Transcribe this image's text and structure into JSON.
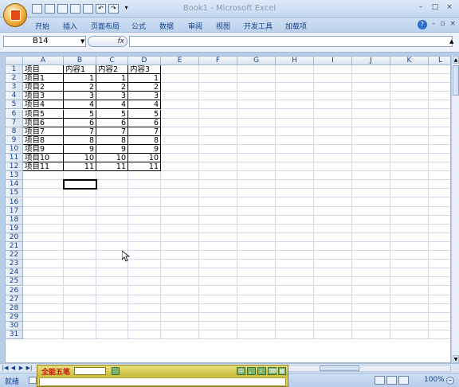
{
  "window": {
    "title": "Book1 - Microsoft Excel",
    "controls": [
      "–",
      "□",
      "×"
    ]
  },
  "qat": {
    "undo_symbol": "↶",
    "redo_symbol": "↷",
    "more_symbol": "▾"
  },
  "ribbon": {
    "tabs": [
      "开始",
      "插入",
      "页面布局",
      "公式",
      "数据",
      "审阅",
      "视图",
      "开发工具",
      "加载项"
    ],
    "help": "?",
    "right_controls": [
      "–",
      "▫",
      "×"
    ]
  },
  "formula_bar": {
    "name_box": "B14",
    "fx_label": "fx",
    "formula": ""
  },
  "columns": [
    "A",
    "B",
    "C",
    "D",
    "E",
    "F",
    "G",
    "H",
    "I",
    "J",
    "K",
    "L"
  ],
  "rows": [
    "1",
    "2",
    "3",
    "4",
    "5",
    "6",
    "7",
    "8",
    "9",
    "10",
    "11",
    "12",
    "13",
    "14",
    "15",
    "16",
    "17",
    "18",
    "19",
    "20",
    "21",
    "22",
    "23",
    "24",
    "25",
    "26",
    "27",
    "28",
    "29",
    "30",
    "31"
  ],
  "table": {
    "header": [
      "项目",
      "内容1",
      "内容2",
      "内容3"
    ],
    "rows": [
      [
        "项目1",
        "1",
        "1",
        "1"
      ],
      [
        "项目2",
        "2",
        "2",
        "2"
      ],
      [
        "项目3",
        "3",
        "3",
        "3"
      ],
      [
        "项目4",
        "4",
        "4",
        "4"
      ],
      [
        "项目5",
        "5",
        "5",
        "5"
      ],
      [
        "项目6",
        "6",
        "6",
        "6"
      ],
      [
        "项目7",
        "7",
        "7",
        "7"
      ],
      [
        "项目8",
        "8",
        "8",
        "8"
      ],
      [
        "项目9",
        "9",
        "9",
        "9"
      ],
      [
        "项目10",
        "10",
        "10",
        "10"
      ],
      [
        "项目11",
        "11",
        "11",
        "11"
      ]
    ]
  },
  "active_cell": "B14",
  "status": {
    "ready": "就绪",
    "zoom": "100%",
    "zoom_out": "–"
  },
  "ime": {
    "name": "全能五笔"
  },
  "colors": {
    "accent": "#15428b",
    "grid_line": "#d0d7e5",
    "header_bg": "#d9e3f0"
  }
}
